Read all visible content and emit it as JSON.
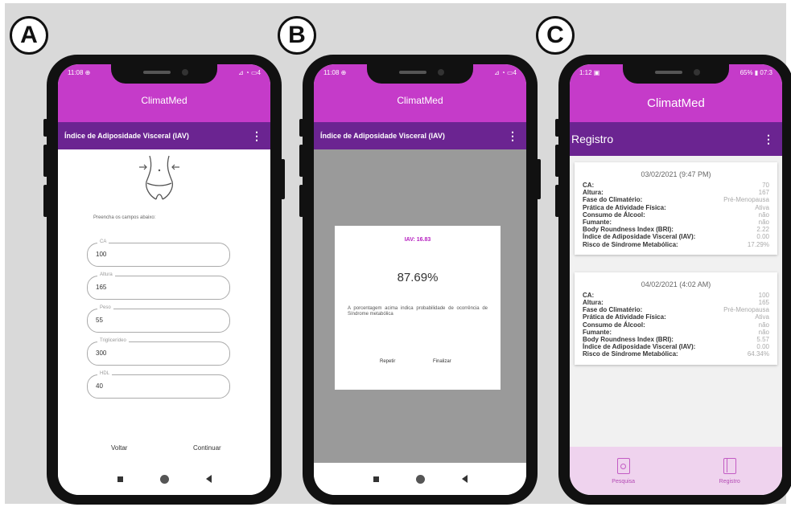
{
  "labels": [
    "A",
    "B",
    "C"
  ],
  "app": {
    "name": "ClimatMed",
    "status_left_a": "11:08 ⊕",
    "status_right_a": "⊿ ◔ ▭4",
    "status_left_c": "1:12 ▣",
    "status_right_c": "65% ▮ 07:3"
  },
  "screen_a": {
    "toolbar_title": "Índice de Adiposidade Visceral (IAV)",
    "instruction": "Preencha os campos abaixo:",
    "fields": [
      {
        "label": "CA",
        "value": "100"
      },
      {
        "label": "Altura",
        "value": "165"
      },
      {
        "label": "Peso",
        "value": "55"
      },
      {
        "label": "Triglicerídeo",
        "value": "300"
      },
      {
        "label": "HDL",
        "value": "40"
      }
    ],
    "back_label": "Voltar",
    "continue_label": "Continuar"
  },
  "screen_b": {
    "toolbar_title": "Índice de Adiposidade Visceral (IAV)",
    "iav_label": "IAV: 16.83",
    "percentage": "87.69%",
    "description": "A porcentagem acima indica probabilidade de ocorrência de Síndrome metabólica",
    "repeat_label": "Repetir",
    "finish_label": "Finalizar"
  },
  "screen_c": {
    "toolbar_title": "Registro",
    "records": [
      {
        "date": "03/02/2021 (9:47 PM)",
        "rows": [
          {
            "k": "CA:",
            "v": "70"
          },
          {
            "k": "Altura:",
            "v": "167"
          },
          {
            "k": "Fase do Climatério:",
            "v": "Pré-Menopausa"
          },
          {
            "k": "Prática de Atividade Física:",
            "v": "Ativa"
          },
          {
            "k": "Consumo de Álcool:",
            "v": "não"
          },
          {
            "k": "Fumante:",
            "v": "não"
          },
          {
            "k": "Body Roundness Index (BRI):",
            "v": "2.22"
          },
          {
            "k": "Índice de Adiposidade Visceral (IAV):",
            "v": "0.00"
          },
          {
            "k": "Risco de Síndrome Metabólica:",
            "v": "17.29%"
          }
        ]
      },
      {
        "date": "04/02/2021 (4:02 AM)",
        "rows": [
          {
            "k": "CA:",
            "v": "100"
          },
          {
            "k": "Altura:",
            "v": "165"
          },
          {
            "k": "Fase do Climatério:",
            "v": "Pré-Menopausa"
          },
          {
            "k": "Prática de Atividade Física:",
            "v": "Ativa"
          },
          {
            "k": "Consumo de Álcool:",
            "v": "não"
          },
          {
            "k": "Fumante:",
            "v": "não"
          },
          {
            "k": "Body Roundness Index (BRI):",
            "v": "5.57"
          },
          {
            "k": "Índice de Adiposidade Visceral (IAV):",
            "v": "0.00"
          },
          {
            "k": "Risco de Síndrome Metabólica:",
            "v": "64.34%"
          }
        ]
      }
    ],
    "nav": [
      {
        "label": "Pesquisa",
        "icon": "form-icon"
      },
      {
        "label": "Registro",
        "icon": "book-icon"
      }
    ]
  },
  "colors": {
    "appbar": "#c53bc9",
    "toolbar": "#6b2491",
    "accent_text": "#b620c0",
    "bottom_nav": "#efd3ee"
  }
}
